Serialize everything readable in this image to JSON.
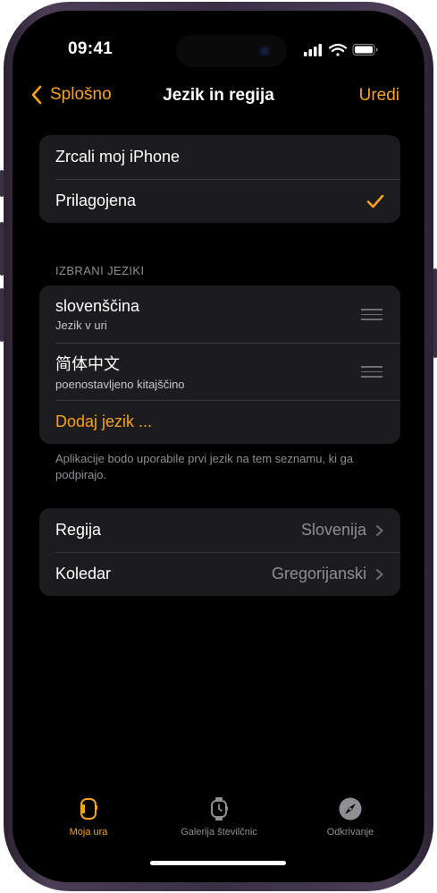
{
  "status": {
    "time": "09:41"
  },
  "nav": {
    "back_label": "Splošno",
    "title": "Jezik in regija",
    "edit_label": "Uredi"
  },
  "mode": [
    {
      "label": "Zrcali moj iPhone",
      "selected": false
    },
    {
      "label": "Prilagojena",
      "selected": true
    }
  ],
  "languages": {
    "header": "IZBRANI JEZIKI",
    "items": [
      {
        "name": "slovenščina",
        "subtitle": "Jezik v uri"
      },
      {
        "name": "简体中文",
        "subtitle": "poenostavljeno kitajščino"
      }
    ],
    "add_label": "Dodaj jezik ...",
    "footer": "Aplikacije bodo uporabile prvi jezik na tem seznamu, ki ga podpirajo."
  },
  "region": [
    {
      "label": "Regija",
      "value": "Slovenija"
    },
    {
      "label": "Koledar",
      "value": "Gregorijanski"
    }
  ],
  "tabs": [
    {
      "label": "Moja ura",
      "active": true
    },
    {
      "label": "Galerija številčnic",
      "active": false
    },
    {
      "label": "Odkrivanje",
      "active": false
    }
  ],
  "colors": {
    "accent": "#f7a21b",
    "background": "#000000",
    "cell": "#1c1c1e",
    "secondary_text": "#8e8e93"
  }
}
